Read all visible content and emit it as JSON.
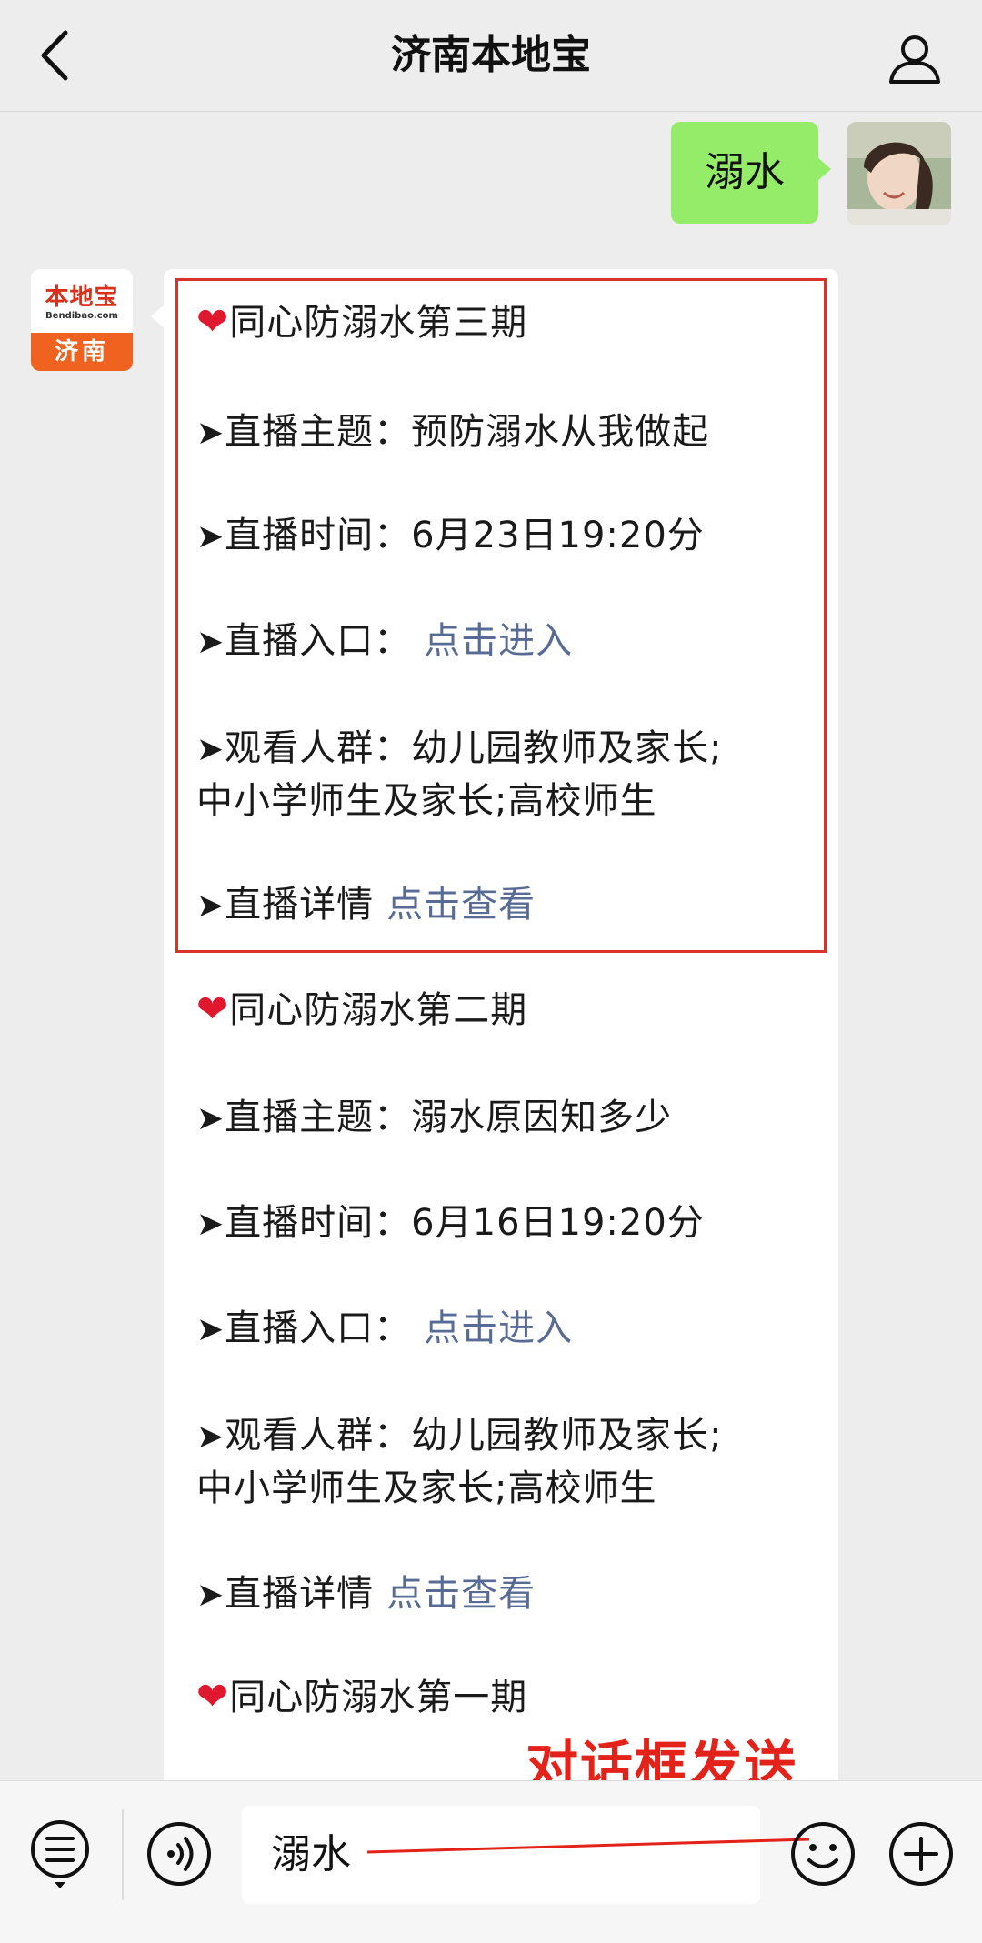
{
  "header": {
    "title": "济南本地宝"
  },
  "sent_message": {
    "text": "溺水"
  },
  "official_account": {
    "logo_main": "本地宝",
    "logo_domain": "Bendibao.com",
    "logo_city": "济南"
  },
  "message": {
    "issue3": {
      "title": "同心防溺水第三期",
      "theme_label": "直播主题：",
      "theme_value": "预防溺水从我做起",
      "time_label": "直播时间：",
      "time_value": "6月23日19:20分",
      "entry_label": "直播入口：",
      "entry_link": "点击进入",
      "audience_label": "观看人群：",
      "audience_value_1": "幼儿园教师及家长;",
      "audience_value_2": "中小学师生及家长;高校师生",
      "detail_label": "直播详情",
      "detail_link": "点击查看"
    },
    "issue2": {
      "title": "同心防溺水第二期",
      "theme_label": "直播主题：",
      "theme_value": "溺水原因知多少",
      "time_label": "直播时间：",
      "time_value": "6月16日19:20分",
      "entry_label": "直播入口：",
      "entry_link": "点击进入",
      "audience_label": "观看人群：",
      "audience_value_1": "幼儿园教师及家长;",
      "audience_value_2": "中小学师生及家长;高校师生",
      "detail_label": "直播详情",
      "detail_link": "点击查看"
    },
    "issue1": {
      "title": "同心防溺水第一期"
    }
  },
  "annotation": "对话框发送",
  "input_bar": {
    "value": "溺水"
  },
  "icons": {
    "back": "chevron-left-icon",
    "profile": "person-icon",
    "menu": "list-menu-icon",
    "voice": "voice-icon",
    "emoji": "smiley-icon",
    "plus": "plus-icon",
    "heart": "heart-icon"
  },
  "colors": {
    "background": "#ededed",
    "sent_bubble": "#95ec69",
    "link": "#576b95",
    "highlight": "#d8322a",
    "heart": "#e0182d"
  }
}
